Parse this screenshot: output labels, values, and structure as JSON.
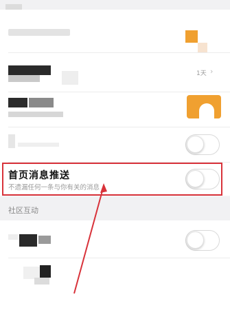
{
  "rows": {
    "row2_meta": "1天",
    "home_push": {
      "title": "首页消息推送",
      "subtitle": "不遗漏任何一条与你有关的消息",
      "toggle_on": false
    }
  },
  "section": {
    "community_header": "社区互动"
  },
  "colors": {
    "highlight_border": "#d8323a",
    "accent_orange": "#f0a030"
  },
  "icons": [
    "chevron-right-icon",
    "toggle-switch"
  ]
}
